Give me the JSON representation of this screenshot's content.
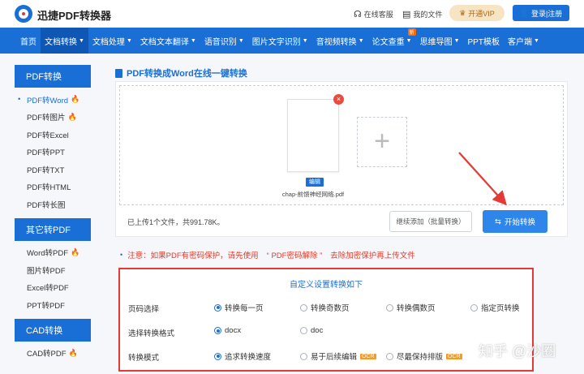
{
  "header": {
    "brand": "迅捷PDF转换器",
    "service": "在线客服",
    "my_files": "我的文件",
    "vip": "开通VIP",
    "login": "登录|注册"
  },
  "nav": {
    "items": [
      {
        "label": "首页",
        "caret": false,
        "active": false
      },
      {
        "label": "文档转换",
        "caret": true,
        "active": true
      },
      {
        "label": "文档处理",
        "caret": true,
        "active": false
      },
      {
        "label": "文档文本翻译",
        "caret": true,
        "active": false
      },
      {
        "label": "语音识别",
        "caret": true,
        "active": false
      },
      {
        "label": "图片文字识别",
        "caret": true,
        "active": false
      },
      {
        "label": "音视频转换",
        "caret": true,
        "active": false
      },
      {
        "label": "论文查重",
        "caret": true,
        "active": false
      },
      {
        "label": "思维导图",
        "caret": true,
        "active": false
      },
      {
        "label": "PPT模板",
        "caret": false,
        "active": false
      },
      {
        "label": "客户端",
        "caret": true,
        "active": false
      }
    ],
    "new_badge": "新"
  },
  "sidebar": {
    "sections": [
      {
        "title": "PDF转换",
        "items": [
          {
            "label": "PDF转Word",
            "hot": true,
            "active": true
          },
          {
            "label": "PDF转图片",
            "hot": true,
            "active": false
          },
          {
            "label": "PDF转Excel",
            "hot": false,
            "active": false
          },
          {
            "label": "PDF转PPT",
            "hot": false,
            "active": false
          },
          {
            "label": "PDF转TXT",
            "hot": false,
            "active": false
          },
          {
            "label": "PDF转HTML",
            "hot": false,
            "active": false
          },
          {
            "label": "PDF转长图",
            "hot": false,
            "active": false
          }
        ]
      },
      {
        "title": "其它转PDF",
        "items": [
          {
            "label": "Word转PDF",
            "hot": true,
            "active": false
          },
          {
            "label": "图片转PDF",
            "hot": false,
            "active": false
          },
          {
            "label": "Excel转PDF",
            "hot": false,
            "active": false
          },
          {
            "label": "PPT转PDF",
            "hot": false,
            "active": false
          }
        ]
      },
      {
        "title": "CAD转换",
        "items": [
          {
            "label": "CAD转PDF",
            "hot": true,
            "active": false
          }
        ]
      }
    ]
  },
  "main": {
    "title": "PDF转换成Word在线一键转换",
    "file": {
      "edit_label": "编辑",
      "name": "chap-前馈神经网络.pdf"
    },
    "add_symbol": "+",
    "uploaded_info": "已上传1个文件，共991.78K。",
    "add_more": "继续添加（批量转换）",
    "start": "开始转换"
  },
  "notice": {
    "prefix": "注意：如果PDF有密码保护，请先使用",
    "link": "“ PDF密码解除 ”",
    "suffix": "去除加密保护再上传文件"
  },
  "settings": {
    "title": "自定义设置转换如下",
    "rows": [
      {
        "label": "页码选择",
        "options": [
          {
            "label": "转换每一页",
            "selected": true,
            "ocr": false
          },
          {
            "label": "转换奇数页",
            "selected": false,
            "ocr": false
          },
          {
            "label": "转换偶数页",
            "selected": false,
            "ocr": false
          },
          {
            "label": "指定页转换",
            "selected": false,
            "ocr": false
          }
        ]
      },
      {
        "label": "选择转换格式",
        "options": [
          {
            "label": "docx",
            "selected": true,
            "ocr": false
          },
          {
            "label": "doc",
            "selected": false,
            "ocr": false
          }
        ]
      },
      {
        "label": "转换模式",
        "options": [
          {
            "label": "追求转换速度",
            "selected": true,
            "ocr": false
          },
          {
            "label": "易于后续编辑",
            "selected": false,
            "ocr": true
          },
          {
            "label": "尽最保持排版",
            "selected": false,
            "ocr": true
          }
        ]
      }
    ],
    "ocr_label": "OCR"
  },
  "watermark": "知乎 @沙圈",
  "colors": {
    "primary": "#1a6fd6",
    "alert": "#e53935",
    "ocr": "#f59a23"
  }
}
